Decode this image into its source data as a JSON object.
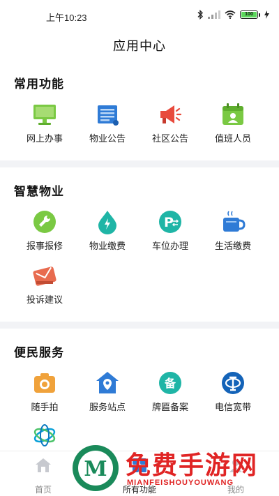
{
  "status_bar": {
    "time": "上午10:23",
    "battery": "100"
  },
  "header": {
    "title": "应用中心"
  },
  "sections": {
    "common": {
      "title": "常用功能",
      "items": [
        {
          "label": "网上办事",
          "icon": "monitor-icon"
        },
        {
          "label": "物业公告",
          "icon": "notice-scroll-icon"
        },
        {
          "label": "社区公告",
          "icon": "megaphone-icon"
        },
        {
          "label": "值班人员",
          "icon": "duty-calendar-icon"
        }
      ]
    },
    "smart": {
      "title": "智慧物业",
      "items": [
        {
          "label": "报事报修",
          "icon": "wrench-icon"
        },
        {
          "label": "物业缴费",
          "icon": "water-drop-icon"
        },
        {
          "label": "车位办理",
          "icon": "parking-icon"
        },
        {
          "label": "生活缴费",
          "icon": "cup-icon"
        },
        {
          "label": "投诉建议",
          "icon": "envelope-icon"
        }
      ]
    },
    "service": {
      "title": "便民服务",
      "items": [
        {
          "label": "随手拍",
          "icon": "camera-icon"
        },
        {
          "label": "服务站点",
          "icon": "location-house-icon"
        },
        {
          "label": "牌匾备案",
          "icon": "record-icon"
        },
        {
          "label": "电信宽带",
          "icon": "china-telecom-icon"
        },
        {
          "label": "",
          "icon": "china-mobile-icon"
        }
      ]
    }
  },
  "tabbar": {
    "items": [
      {
        "label": "首页",
        "icon": "home-icon"
      },
      {
        "label": "所有功能",
        "icon": "grid-icon"
      },
      {
        "label": "我的",
        "icon": "user-icon"
      }
    ]
  },
  "watermark": {
    "text": "免费手游网",
    "sub": "MIANFEISHOUYOUWANG"
  },
  "colors": {
    "green": "#7ac943",
    "blue": "#2f7bd6",
    "red": "#e84a3c",
    "orange": "#f0a23b",
    "teal": "#1fb5a6"
  }
}
